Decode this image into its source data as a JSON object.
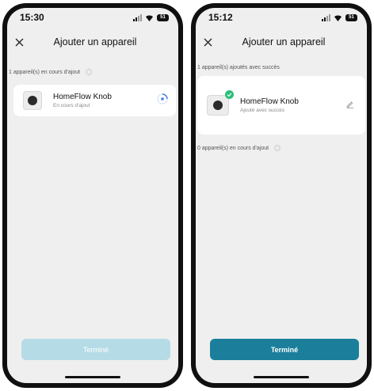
{
  "left": {
    "time": "15:30",
    "battery": "51",
    "title": "Ajouter un appareil",
    "section_label": "1 appareil(s) en cours d'ajout",
    "device": {
      "name": "HomeFlow Knob",
      "status": "En cours d'ajout"
    },
    "done_label": "Terminé",
    "done_color": "#b5dce6"
  },
  "right": {
    "time": "15:12",
    "battery": "51",
    "title": "Ajouter un appareil",
    "success_label": "1 appareil(s) ajoutés avec succès",
    "device": {
      "name": "HomeFlow Knob",
      "status": "Ajouté avec succès"
    },
    "pending_label": "0 appareil(s) en cours d'ajout",
    "done_label": "Terminé",
    "done_color": "#1b7f9b"
  },
  "colors": {
    "accent": "#1b7f9b",
    "success": "#2bbf7a",
    "progress": "#3d7de0"
  },
  "icons": [
    "close-icon",
    "signal-icon",
    "wifi-icon",
    "battery-icon",
    "spinner-icon",
    "progress-icon",
    "check-badge-icon",
    "edit-icon"
  ]
}
